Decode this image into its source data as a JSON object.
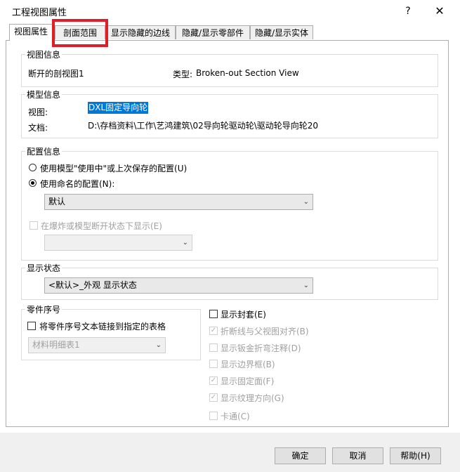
{
  "window": {
    "title": "工程视图属性",
    "help": "?",
    "close": "✕"
  },
  "tabs": [
    "视图属性",
    "剖面范围",
    "显示隐藏的边线",
    "隐藏/显示零部件",
    "隐藏/显示实体"
  ],
  "view_info": {
    "label": "视图信息",
    "name": "断开的剖视图1",
    "type_label": "类型:",
    "type_value": "Broken-out Section View"
  },
  "model_info": {
    "label": "模型信息",
    "view_label": "视图:",
    "view_value": "DXL固定导向轮",
    "doc_label": "文档:",
    "doc_value": "D:\\存档资料\\工作\\艺鸿建筑\\02导向轮驱动轮\\驱动轮导向轮20"
  },
  "config_info": {
    "label": "配置信息",
    "radio_use_model": "使用模型\"使用中\"或上次保存的配置(U)",
    "radio_use_named": "使用命名的配置(N):",
    "named_value": "默认",
    "explode_label": "在爆炸或模型断开状态下显示(E)",
    "explode_combo": ""
  },
  "display_state": {
    "label": "显示状态",
    "value": "<默认>_外观 显示状态"
  },
  "balloon": {
    "label": "零件序号",
    "link_label": "将零件序号文本链接到指定的表格",
    "table_value": "材料明细表1"
  },
  "options": [
    {
      "label": "显示封套(E)",
      "checked": false,
      "enabled": true
    },
    {
      "label": "折断线与父视图对齐(B)",
      "checked": true,
      "enabled": false
    },
    {
      "label": "显示钣金折弯注释(D)",
      "checked": false,
      "enabled": false
    },
    {
      "label": "显示边界框(B)",
      "checked": false,
      "enabled": false
    },
    {
      "label": "显示固定面(F)",
      "checked": true,
      "enabled": false
    },
    {
      "label": "显示纹理方向(G)",
      "checked": true,
      "enabled": false
    },
    {
      "label": "卡通(C)",
      "checked": false,
      "enabled": false
    }
  ],
  "buttons": {
    "ok": "确定",
    "cancel": "取消",
    "help": "帮助(H)"
  },
  "colors": {
    "highlight": "#e11d2a",
    "selection": "#0078d7"
  }
}
